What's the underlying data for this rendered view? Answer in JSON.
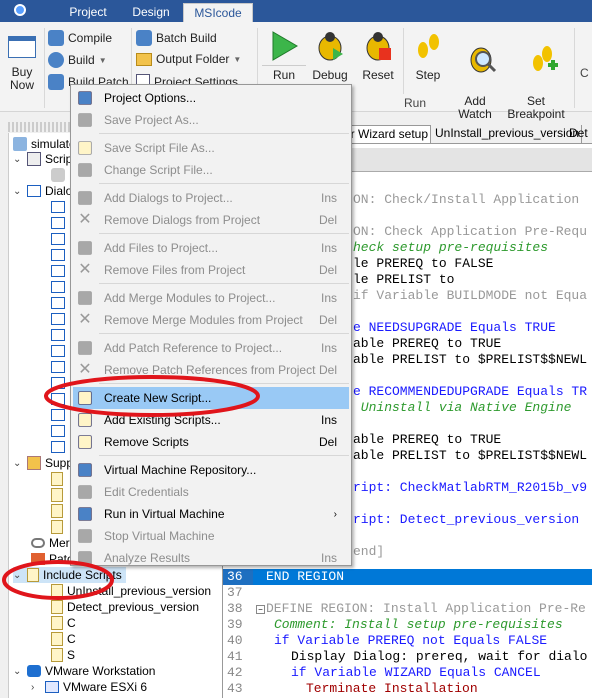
{
  "tabs": [
    {
      "label": "Project"
    },
    {
      "label": "Design"
    },
    {
      "label": "MSIcode",
      "active": true
    }
  ],
  "ribbon": {
    "buy_now": "Buy\nNow",
    "compile": "Compile",
    "build": "Build",
    "build_patch": "Build Patch",
    "batch_build": "Batch Build",
    "output_folder": "Output Folder",
    "project_settings": "Project Settings",
    "run": "Run",
    "debug": "Debug",
    "reset": "Reset",
    "step": "Step",
    "add_watch": "Add\nWatch",
    "set_breakpoint": "Set\nBreakpoint",
    "run_group": "Run",
    "cut": "C"
  },
  "tree": {
    "root": "simulator",
    "scripts": "Scrip",
    "dialogs": "Dialo",
    "support": "Supp",
    "merge": "Merg",
    "patch": "Patc",
    "include_scripts": "Include Scripts",
    "include_children": [
      "UnInstall_previous_version",
      "Detect_previous_version",
      "C",
      "C",
      "S"
    ],
    "vmware": "VMware Workstation",
    "esxi": "VMware ESXi 6"
  },
  "editor": {
    "tabs": [
      "or Wizard setup",
      "UnInstall_previous_version",
      "Det"
    ],
    "lines": [
      {
        "t": "ON: Check/Install Application",
        "c": "#999999"
      },
      {
        "t": "",
        "c": "#000"
      },
      {
        "t": "ON: Check Application Pre-Requ",
        "c": "#999999"
      },
      {
        "t": "heck setup pre-requisites",
        "c": "#2e9a2e",
        "i": true
      },
      {
        "t": "le PREREQ to FALSE",
        "c": "#000"
      },
      {
        "t": "le PRELIST to",
        "c": "#000"
      },
      {
        "t": "if Variable BUILDMODE not Equa",
        "c": "#999999"
      },
      {
        "t": "",
        "c": "#000"
      },
      {
        "t": "e NEEDSUPGRADE Equals TRUE",
        "c": "#1a1aff"
      },
      {
        "t": "able PREREQ to TRUE",
        "c": "#000"
      },
      {
        "t": "able PRELIST to $PRELIST$$NEWL",
        "c": "#000"
      },
      {
        "t": "",
        "c": "#000"
      },
      {
        "t": "e RECOMMENDEDUPGRADE Equals TR",
        "c": "#1a1aff"
      },
      {
        "t": " Uninstall via Native Engine",
        "c": "#2e9a2e",
        "i": true
      },
      {
        "t": "",
        "c": "#000"
      },
      {
        "t": "able PREREQ to TRUE",
        "c": "#000"
      },
      {
        "t": "able PRELIST to $PRELIST$$NEWL",
        "c": "#000"
      },
      {
        "t": "",
        "c": "#000"
      },
      {
        "t": "ript: CheckMatlabRTM_R2015b_v9",
        "c": "#1a1aff"
      },
      {
        "t": "",
        "c": "#000"
      },
      {
        "t": "ript: Detect_previous_version",
        "c": "#1a1aff"
      },
      {
        "t": "",
        "c": "#000"
      },
      {
        "t": "end]",
        "c": "#999999"
      }
    ],
    "numbered": [
      {
        "n": "36",
        "t": "END REGION",
        "c": "#ffffff",
        "sel": true,
        "x": 12
      },
      {
        "n": "37",
        "t": "",
        "c": "#000",
        "x": 12
      },
      {
        "n": "38",
        "t": "DEFINE REGION: Install Application Pre-Re",
        "c": "#999999",
        "x": 12,
        "fold": true
      },
      {
        "n": "39",
        "t": "Comment: Install setup pre-requisites",
        "c": "#2e9a2e",
        "x": 20,
        "i": true
      },
      {
        "n": "40",
        "t": "if Variable PREREQ not Equals FALSE",
        "c": "#1a1aff",
        "x": 20
      },
      {
        "n": "41",
        "t": "Display Dialog: prereq, wait for dialo",
        "c": "#000",
        "x": 37
      },
      {
        "n": "42",
        "t": "if Variable WIZARD Equals CANCEL",
        "c": "#1a1aff",
        "x": 37
      },
      {
        "n": "43",
        "t": "Terminate Installation",
        "c": "#a00000",
        "x": 52
      }
    ]
  },
  "menu": {
    "items": [
      {
        "label": "Project Options...",
        "icon": "project-options-icon"
      },
      {
        "label": "Save Project As...",
        "disabled": true,
        "icon": "save-icon"
      },
      {
        "sep": true
      },
      {
        "label": "Save Script File As...",
        "disabled": true,
        "icon": "script-icon"
      },
      {
        "label": "Change Script File...",
        "disabled": true,
        "icon": "folder-icon"
      },
      {
        "sep": true
      },
      {
        "label": "Add Dialogs to Project...",
        "shortcut": "Ins",
        "disabled": true,
        "icon": "add-icon"
      },
      {
        "label": "Remove Dialogs from Project",
        "shortcut": "Del",
        "disabled": true,
        "icon": "remove-icon"
      },
      {
        "sep": true
      },
      {
        "label": "Add Files to Project...",
        "shortcut": "Ins",
        "disabled": true,
        "icon": "add-icon"
      },
      {
        "label": "Remove Files from Project",
        "shortcut": "Del",
        "disabled": true,
        "icon": "remove-icon"
      },
      {
        "sep": true
      },
      {
        "label": "Add Merge Modules to Project...",
        "shortcut": "Ins",
        "disabled": true,
        "icon": "merge-icon"
      },
      {
        "label": "Remove Merge Modules from Project",
        "shortcut": "Del",
        "disabled": true,
        "icon": "remove-icon"
      },
      {
        "sep": true
      },
      {
        "label": "Add Patch Reference to Project...",
        "shortcut": "Ins",
        "disabled": true,
        "icon": "patch-icon"
      },
      {
        "label": "Remove Patch References from Project",
        "shortcut": "Del",
        "disabled": true,
        "icon": "remove-icon"
      },
      {
        "sep": true
      },
      {
        "label": "Create New Script...",
        "highlighted": true,
        "icon": "new-script-icon"
      },
      {
        "label": "Add Existing Scripts...",
        "shortcut": "Ins",
        "icon": "add-script-icon"
      },
      {
        "label": "Remove Scripts",
        "shortcut": "Del",
        "icon": "remove-script-icon"
      },
      {
        "sep": true
      },
      {
        "label": "Virtual Machine Repository...",
        "icon": "vm-repository-icon"
      },
      {
        "label": "Edit Credentials",
        "disabled": true,
        "icon": "credentials-icon"
      },
      {
        "label": "Run in Virtual Machine",
        "submenu": true,
        "icon": "run-vm-icon"
      },
      {
        "label": "Stop Virtual Machine",
        "disabled": true,
        "icon": "stop-vm-icon"
      },
      {
        "label": "Analyze Results",
        "shortcut": "Ins",
        "disabled": true,
        "icon": "analyze-icon"
      }
    ]
  },
  "colors": {
    "titlebar": "#2b579a",
    "highlight": "#99c9f5",
    "selection": "#0078d7",
    "annotation": "#e0151b"
  }
}
